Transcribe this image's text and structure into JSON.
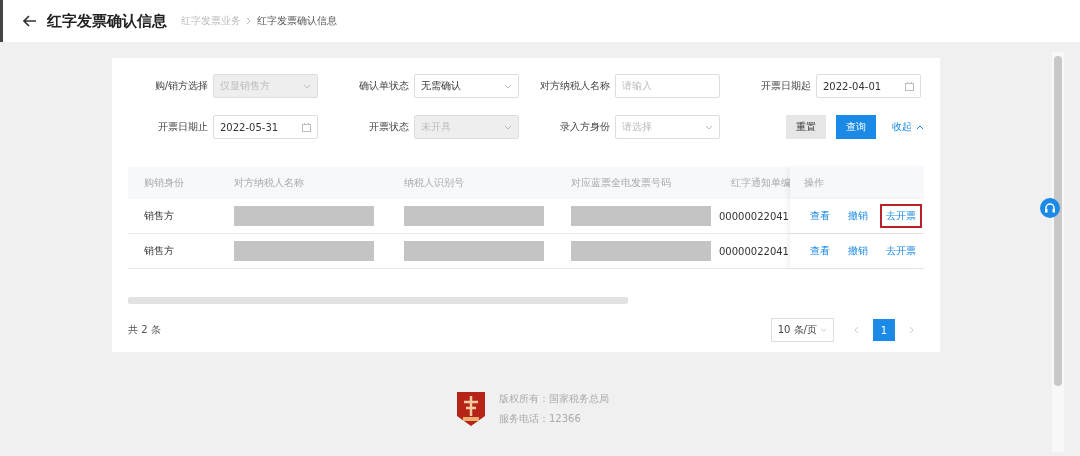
{
  "header": {
    "title": "红字发票确认信息",
    "breadcrumb": [
      {
        "label": "红字发票业务",
        "selected": false
      },
      {
        "label": "红字发票确认信息",
        "selected": true
      }
    ]
  },
  "filters": [
    {
      "kind": "select",
      "label": "购/销方选择",
      "value": "仅显销售方",
      "disabled": true
    },
    {
      "kind": "select",
      "label": "确认单状态",
      "value": "无需确认",
      "disabled": false
    },
    {
      "kind": "input",
      "label": "对方纳税人名称",
      "placeholder": "请输入",
      "disabled": false
    },
    {
      "kind": "date",
      "label": "开票日期起",
      "value": "2022-04-01",
      "disabled": false
    },
    {
      "kind": "date",
      "label": "开票日期止",
      "value": "2022-05-31",
      "disabled": false
    },
    {
      "kind": "select",
      "label": "开票状态",
      "value": "未开具",
      "disabled": true
    },
    {
      "kind": "select",
      "label": "录入方身份",
      "placeholder": "请选择",
      "disabled": false
    }
  ],
  "buttons": {
    "reset": "重置",
    "search": "查询",
    "collapse": "收起"
  },
  "table": {
    "columns": [
      "购销身份",
      "对方纳税人名称",
      "纳税人识别号",
      "对应蓝票全电发票号码",
      "红字通知单编",
      "操作"
    ],
    "rows": [
      {
        "role": "销售方",
        "notice_no": "00000022041",
        "actions": [
          {
            "label": "查看",
            "highlighted": false
          },
          {
            "label": "撤销",
            "highlighted": false
          },
          {
            "label": "去开票",
            "highlighted": true
          }
        ]
      },
      {
        "role": "销售方",
        "notice_no": "00000022041",
        "actions": [
          {
            "label": "查看",
            "highlighted": false
          },
          {
            "label": "撤销",
            "highlighted": false
          },
          {
            "label": "去开票",
            "highlighted": false
          }
        ]
      }
    ]
  },
  "pagination": {
    "total": "共 2 条",
    "page_size": "10 条/页",
    "pages": [
      {
        "label": "1",
        "selected": true
      }
    ]
  },
  "footer": {
    "copyright": "版权所有：国家税务总局",
    "phone": "服务电话：12366"
  }
}
